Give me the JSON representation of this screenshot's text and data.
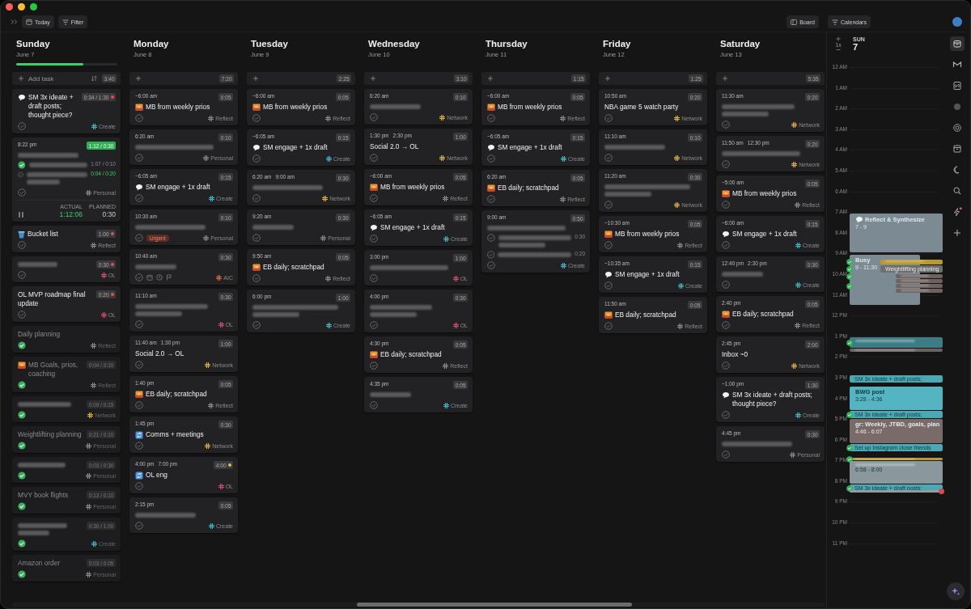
{
  "toolbar": {
    "today": "Today",
    "filter": "Filter",
    "board": "Board",
    "calendars": "Calendars"
  },
  "days": [
    {
      "name": "Sunday",
      "date": "June 7",
      "level": 0.66,
      "add_label": "Add task",
      "show_sort": true,
      "total": "3:40",
      "tasks": [
        {
          "kind": "speech",
          "title": "SM 3x ideate + draft posts; thought piece?",
          "duration": "0:34 / 1:30",
          "color": "#e0504a",
          "done": false,
          "tag": {
            "name": "Create",
            "color": "#3fb6c6"
          }
        },
        {
          "time": "8:22 pm",
          "blurred": true,
          "duration": "1:12 / 0:30",
          "running": true,
          "done": false,
          "subtasks": [
            {
              "done": true,
              "blurred": true,
              "duration": "1:07 / 0:10",
              "running": false
            },
            {
              "done": false,
              "blurred": true,
              "wrapped": true,
              "duration": "0:04 / 0:20",
              "running": true
            }
          ],
          "tag": {
            "name": "Personal",
            "color": "#8a8a8a"
          },
          "timer": {
            "actual_label": "ACTUAL",
            "actual": "1:12:06",
            "planned_label": "PLANNED",
            "planned": "0:30"
          }
        },
        {
          "kind": "bucket",
          "title": "Bucket list",
          "duration": "1:00",
          "color": "#e0504a",
          "done": false,
          "tag": {
            "name": "Reflect",
            "color": "#8a8a8a"
          }
        },
        {
          "blurred": true,
          "duration": "0:30",
          "color": "#e0504a",
          "done": false,
          "tag": {
            "name": "OL",
            "color": "#d24d6c"
          }
        },
        {
          "title": "OL MVP roadmap final update",
          "duration": "0:20",
          "color": "#e0504a",
          "done": false,
          "tag": {
            "name": "OL",
            "color": "#d24d6c"
          }
        },
        {
          "title": "Daily planning",
          "done": true,
          "tag": {
            "name": "Reflect",
            "color": "#8a8a8a"
          }
        },
        {
          "kind": "sunrise",
          "title": "MB Goals, prios, coaching",
          "duration": "0:04 / 0:10",
          "done": true,
          "tag": {
            "name": "Reflect",
            "color": "#8a8a8a"
          }
        },
        {
          "blurred": true,
          "duration": "0:09 / 0:15",
          "done": true,
          "tag": {
            "name": "Network",
            "color": "#e0b23a"
          }
        },
        {
          "title": "Weightlifting planning",
          "duration": "0:21 / 0:10",
          "done": true,
          "tag": {
            "name": "Personal",
            "color": "#8a8a8a"
          }
        },
        {
          "blurred": true,
          "duration": "0:03 / 0:30",
          "done": true,
          "tag": {
            "name": "Personal",
            "color": "#8a8a8a"
          }
        },
        {
          "title": "MVY book flights",
          "duration": "0:13 / 0:10",
          "done": true,
          "tag": {
            "name": "Personal",
            "color": "#8a8a8a"
          }
        },
        {
          "blurred": true,
          "wrapped": true,
          "duration": "0:30 / 1:00",
          "done": true,
          "tag": {
            "name": "Create",
            "color": "#3fb6c6"
          }
        },
        {
          "title": "Amazon order",
          "duration": "0:03 / 0:05",
          "done": true,
          "tag": {
            "name": "Personal",
            "color": "#8a8a8a"
          }
        }
      ]
    },
    {
      "name": "Monday",
      "date": "June 8",
      "total": "7:20",
      "tasks": [
        {
          "time": "~6:00 am",
          "duration": "0:05",
          "kind": "sunrise",
          "title": "MB from weekly prios",
          "done": false,
          "tag": {
            "name": "Reflect",
            "color": "#8a8a8a"
          }
        },
        {
          "time": "6:20 am",
          "duration": "0:10",
          "blurred": true,
          "done": false,
          "tag": {
            "name": "Personal",
            "color": "#8a8a8a"
          }
        },
        {
          "time": "~6:05 am",
          "duration": "0:15",
          "kind": "speech",
          "title": "SM engage + 1x draft",
          "done": false,
          "tag": {
            "name": "Create",
            "color": "#3fb6c6"
          }
        },
        {
          "time": "10:30 am",
          "duration": "0:10",
          "blurred": true,
          "urgent": "Urgent",
          "done": false,
          "tag": {
            "name": "Personal",
            "color": "#8a8a8a"
          }
        },
        {
          "time": "10:40 am",
          "duration": "0:30",
          "blurred": true,
          "show_actions": true,
          "done": false,
          "tag": {
            "name": "AIC",
            "color": "#e0663e"
          }
        },
        {
          "time": "11:10 am",
          "duration": "0:30",
          "blurred": true,
          "wrapped": true,
          "done": false,
          "tag": {
            "name": "OL",
            "color": "#d24d6c"
          }
        },
        {
          "time": "11:40 am",
          "end_time": "1:30 pm",
          "duration": "1:00",
          "title": "Social 2.0 → OL",
          "done": false,
          "tag": {
            "name": "Network",
            "color": "#e0b23a"
          }
        },
        {
          "time": "1:40 pm",
          "duration": "0:05",
          "kind": "sunrise",
          "title": "EB daily; scratchpad",
          "done": false,
          "tag": {
            "name": "Reflect",
            "color": "#8a8a8a"
          }
        },
        {
          "time": "1:45 pm",
          "duration": "0:30",
          "kind": "sync",
          "title": "Comms + meetings",
          "done": false,
          "tag": {
            "name": "Network",
            "color": "#e0b23a"
          }
        },
        {
          "time": "4:00 pm",
          "end_time": "7:00 pm",
          "duration": "4:00",
          "color": "#e8b838",
          "kind": "sync",
          "title": "OL eng",
          "done": false,
          "tag": {
            "name": "OL",
            "color": "#d24d6c"
          }
        },
        {
          "time": "2:15 pm",
          "duration": "0:05",
          "blurred": true,
          "done": false,
          "tag": {
            "name": "Create",
            "color": "#3fb6c6"
          }
        }
      ]
    },
    {
      "name": "Tuesday",
      "date": "June 9",
      "total": "2:25",
      "tasks": [
        {
          "time": "~6:00 am",
          "duration": "0:05",
          "kind": "sunrise",
          "title": "MB from weekly prios",
          "done": false,
          "tag": {
            "name": "Reflect",
            "color": "#8a8a8a"
          }
        },
        {
          "time": "~6:05 am",
          "duration": "0:15",
          "kind": "speech",
          "title": "SM engage + 1x draft",
          "done": false,
          "tag": {
            "name": "Create",
            "color": "#3fb6c6"
          }
        },
        {
          "time": "6:20 am",
          "end_time": "9:00 am",
          "duration": "0:30",
          "blurred": true,
          "done": false,
          "tag": {
            "name": "Network",
            "color": "#e0b23a"
          }
        },
        {
          "time": "9:20 am",
          "duration": "0:30",
          "blurred": true,
          "done": false,
          "tag": {
            "name": "Personal",
            "color": "#8a8a8a"
          }
        },
        {
          "time": "9:50 am",
          "duration": "0:05",
          "kind": "sunrise",
          "title": "EB daily; scratchpad",
          "done": false,
          "tag": {
            "name": "Reflect",
            "color": "#8a8a8a"
          }
        },
        {
          "time": "6:00 pm",
          "duration": "1:00",
          "blurred": true,
          "wrapped": true,
          "done": false,
          "tag": {
            "name": "Create",
            "color": "#3fb6c6"
          }
        }
      ]
    },
    {
      "name": "Wednesday",
      "date": "June 10",
      "total": "3:10",
      "tasks": [
        {
          "time": "6:20 am",
          "duration": "0:10",
          "blurred": true,
          "done": false,
          "tag": {
            "name": "Network",
            "color": "#e0b23a"
          }
        },
        {
          "time": "1:30 pm",
          "end_time": "2:30 pm",
          "duration": "1:00",
          "title": "Social 2.0 → OL",
          "done": false,
          "tag": {
            "name": "Network",
            "color": "#e0b23a"
          }
        },
        {
          "time": "~6:00 am",
          "duration": "0:05",
          "kind": "sunrise",
          "title": "MB from weekly prios",
          "done": false,
          "tag": {
            "name": "Reflect",
            "color": "#8a8a8a"
          }
        },
        {
          "time": "~6:05 am",
          "duration": "0:15",
          "kind": "speech",
          "title": "SM engage + 1x draft",
          "done": false,
          "tag": {
            "name": "Create",
            "color": "#3fb6c6"
          }
        },
        {
          "time": "3:00 pm",
          "duration": "1:00",
          "blurred": true,
          "done": false,
          "tag": {
            "name": "OL",
            "color": "#d24d6c"
          }
        },
        {
          "time": "4:00 pm",
          "duration": "0:30",
          "blurred": true,
          "wrapped": true,
          "done": false,
          "tag": {
            "name": "OL",
            "color": "#d24d6c"
          }
        },
        {
          "time": "4:30 pm",
          "duration": "0:05",
          "kind": "sunrise",
          "title": "EB daily; scratchpad",
          "done": false,
          "tag": {
            "name": "Reflect",
            "color": "#8a8a8a"
          }
        },
        {
          "time": "4:35 pm",
          "duration": "0:05",
          "blurred": true,
          "done": false,
          "tag": {
            "name": "Create",
            "color": "#3fb6c6"
          }
        }
      ]
    },
    {
      "name": "Thursday",
      "date": "June 11",
      "total": "1:15",
      "tasks": [
        {
          "time": "~6:00 am",
          "duration": "0:05",
          "kind": "sunrise",
          "title": "MB from weekly prios",
          "done": false,
          "tag": {
            "name": "Reflect",
            "color": "#8a8a8a"
          }
        },
        {
          "time": "~6:05 am",
          "duration": "0:15",
          "kind": "speech",
          "title": "SM engage + 1x draft",
          "done": false,
          "tag": {
            "name": "Create",
            "color": "#3fb6c6"
          }
        },
        {
          "time": "6:20 am",
          "duration": "0:05",
          "kind": "sunrise",
          "title": "EB daily; scratchpad",
          "done": false,
          "tag": {
            "name": "Reflect",
            "color": "#8a8a8a"
          }
        },
        {
          "time": "9:00 am",
          "duration": "0:50",
          "blurred": true,
          "done": false,
          "subtasks": [
            {
              "done": false,
              "blurred": true,
              "wrapped": true,
              "duration": "0:30",
              "running": false
            },
            {
              "done": false,
              "blurred": true,
              "duration": "0:20",
              "running": false
            }
          ],
          "tag": {
            "name": "Create",
            "color": "#3fb6c6"
          }
        }
      ]
    },
    {
      "name": "Friday",
      "date": "June 12",
      "total": "1:25",
      "tasks": [
        {
          "time": "10:50 am",
          "duration": "0:20",
          "title": "NBA game 5 watch party",
          "done": false,
          "tag": {
            "name": "Network",
            "color": "#e0b23a"
          }
        },
        {
          "time": "11:10 am",
          "duration": "0:10",
          "blurred": true,
          "done": false,
          "tag": {
            "name": "Network",
            "color": "#e0b23a"
          }
        },
        {
          "time": "11:20 am",
          "duration": "0:30",
          "blurred": true,
          "wrapped": true,
          "done": false,
          "tag": {
            "name": "Network",
            "color": "#e0b23a"
          }
        },
        {
          "time": "~10:30 am",
          "duration": "0:05",
          "kind": "sunrise",
          "title": "MB from weekly prios",
          "done": false,
          "tag": {
            "name": "Reflect",
            "color": "#8a8a8a"
          }
        },
        {
          "time": "~10:35 am",
          "duration": "0:15",
          "kind": "speech",
          "title": "SM engage + 1x draft",
          "done": false,
          "tag": {
            "name": "Create",
            "color": "#3fb6c6"
          }
        },
        {
          "time": "11:50 am",
          "duration": "0:05",
          "kind": "sunrise",
          "title": "EB daily; scratchpad",
          "done": false,
          "tag": {
            "name": "Reflect",
            "color": "#8a8a8a"
          }
        }
      ]
    },
    {
      "name": "Saturday",
      "date": "June 13",
      "total": "5:35",
      "tasks": [
        {
          "time": "11:30 am",
          "duration": "0:20",
          "blurred": true,
          "wrapped": true,
          "done": false,
          "tag": {
            "name": "Network",
            "color": "#e0b23a"
          }
        },
        {
          "time": "11:50 am",
          "end_time": "12:30 pm",
          "duration": "0:20",
          "blurred": true,
          "done": false,
          "tag": {
            "name": "Network",
            "color": "#e0b23a"
          }
        },
        {
          "time": "~5:00 am",
          "duration": "0:05",
          "kind": "sunrise",
          "title": "MB from weekly prios",
          "done": false,
          "tag": {
            "name": "Reflect",
            "color": "#8a8a8a"
          }
        },
        {
          "time": "~6:00 am",
          "duration": "0:15",
          "kind": "speech",
          "title": "SM engage + 1x draft",
          "done": false,
          "tag": {
            "name": "Create",
            "color": "#3fb6c6"
          }
        },
        {
          "time": "12:40 pm",
          "end_time": "2:30 pm",
          "duration": "0:30",
          "blurred": true,
          "done": false,
          "tag": {
            "name": "Create",
            "color": "#3fb6c6"
          }
        },
        {
          "time": "2:40 pm",
          "duration": "0:05",
          "kind": "sunrise",
          "title": "EB daily; scratchpad",
          "done": false,
          "tag": {
            "name": "Reflect",
            "color": "#8a8a8a"
          }
        },
        {
          "time": "2:45 pm",
          "duration": "2:00",
          "title": "Inbox ~0",
          "done": false,
          "tag": {
            "name": "Network",
            "color": "#e0b23a"
          }
        },
        {
          "time": "~1:00 pm",
          "duration": "1:30",
          "kind": "speech",
          "title": "SM 3x ideate + draft posts; thought piece?",
          "done": false,
          "tag": {
            "name": "Create",
            "color": "#3fb6c6"
          }
        },
        {
          "time": "4:45 pm",
          "duration": "0:30",
          "blurred": true,
          "done": false,
          "tag": {
            "name": "Personal",
            "color": "#8a8a8a"
          }
        }
      ]
    }
  ],
  "calendar": {
    "zoom": "1x",
    "weekday": "SUN",
    "day": "7",
    "hours": [
      "12 AM",
      "1 AM",
      "2 AM",
      "3 AM",
      "4 AM",
      "5 AM",
      "6 AM",
      "7 AM",
      "8 AM",
      "9 AM",
      "10 AM",
      "11 AM",
      "12 PM",
      "1 PM",
      "2 PM",
      "3 PM",
      "4 PM",
      "5 PM",
      "6 PM",
      "7 PM",
      "8 PM",
      "9 PM",
      "10 PM",
      "11 PM"
    ],
    "events": [
      {
        "kind": "note",
        "title": "Reflect & Synthesize",
        "time": "7 - 9",
        "color": "#7b8a93",
        "checked": false
      },
      {
        "kind": "block",
        "title": "Busy",
        "time": "9 - 11:30",
        "color": "#7b8a93",
        "checked": false
      },
      {
        "kind": "strip",
        "blurred": true,
        "color": "#b89a2e",
        "checked": true
      },
      {
        "kind": "strip",
        "title": "Weightlifting planning",
        "color": "#6e6e70",
        "checked": true
      },
      {
        "kind": "strip",
        "blurred": true,
        "color": "#6d6260",
        "checked": true
      },
      {
        "kind": "strip",
        "blurred": true,
        "color": "#6d6260",
        "checked": false
      },
      {
        "kind": "strip",
        "blurred": true,
        "color": "#6d6260",
        "checked": true
      },
      {
        "kind": "strip",
        "blurred": true,
        "color": "#6d6260",
        "checked": false
      },
      {
        "kind": "block",
        "blurred": true,
        "color": "#3d7c84",
        "checked": true
      },
      {
        "kind": "strip",
        "blurred": true,
        "color": "#6d6260",
        "checked": false
      },
      {
        "kind": "strip",
        "title": "SM 3x ideate + draft posts;",
        "color": "#4aa9b5",
        "checked": false
      },
      {
        "kind": "block",
        "title": "BWG post",
        "time": "3:28 - 4:36",
        "color": "#55b4c1",
        "checked": false
      },
      {
        "kind": "strip",
        "title": "SM 3x ideate + draft posts;",
        "color": "#4aa9b5",
        "checked": true
      },
      {
        "kind": "block",
        "title": "gr: Weekly, JTBD, goals, plan",
        "time": "4:46 - 6:07",
        "color": "#7a6b68",
        "checked": false
      },
      {
        "kind": "strip",
        "title": "Set up Instagram close friends",
        "color": "#4aa9b5",
        "checked": true
      },
      {
        "kind": "strip",
        "blurred": true,
        "color": "#b89a2e",
        "checked": true
      },
      {
        "kind": "block",
        "blurred": true,
        "time": "6:58 - 8:00",
        "color": "#8a979d",
        "checked": false
      },
      {
        "kind": "strip",
        "title": "SM 3x ideate + draft posts;",
        "color": "#4aa9b5",
        "checked": true
      }
    ]
  }
}
